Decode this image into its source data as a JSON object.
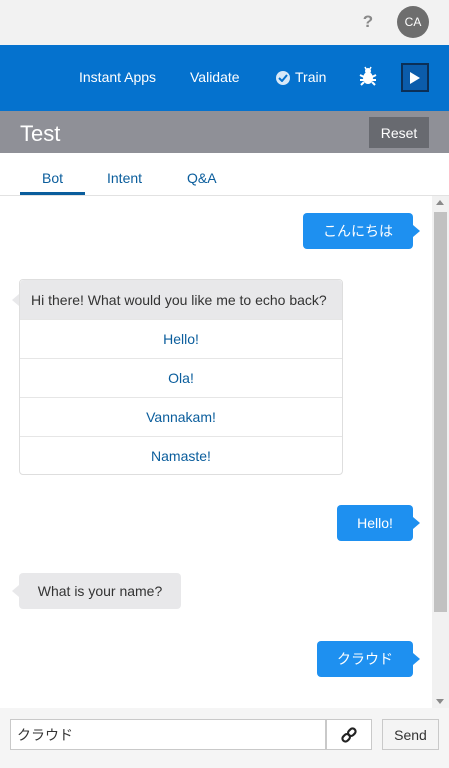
{
  "header": {
    "help_label": "?",
    "avatar_initials": "CA"
  },
  "toolbar": {
    "instant_apps_label": "Instant Apps",
    "validate_label": "Validate",
    "train_label": "Train"
  },
  "test_panel": {
    "title": "Test",
    "reset_label": "Reset"
  },
  "tabs": [
    {
      "label": "Bot",
      "active": true
    },
    {
      "label": "Intent",
      "active": false
    },
    {
      "label": "Q&A",
      "active": false
    }
  ],
  "conversation": {
    "user_msg_1": "こんにちは",
    "bot_card": {
      "prompt": "Hi there! What would you like me to echo back?",
      "options": [
        "Hello!",
        "Ola!",
        "Vannakam!",
        "Namaste!"
      ]
    },
    "user_msg_2": "Hello!",
    "bot_msg_2": "What is your name?",
    "user_msg_3": "クラウド"
  },
  "composer": {
    "input_value": "クラウド",
    "send_label": "Send"
  },
  "colors": {
    "accent": "#0572ce",
    "user_bubble": "#1e90f0",
    "bot_bubble": "#e8e8ea",
    "link": "#0a5d9c"
  }
}
